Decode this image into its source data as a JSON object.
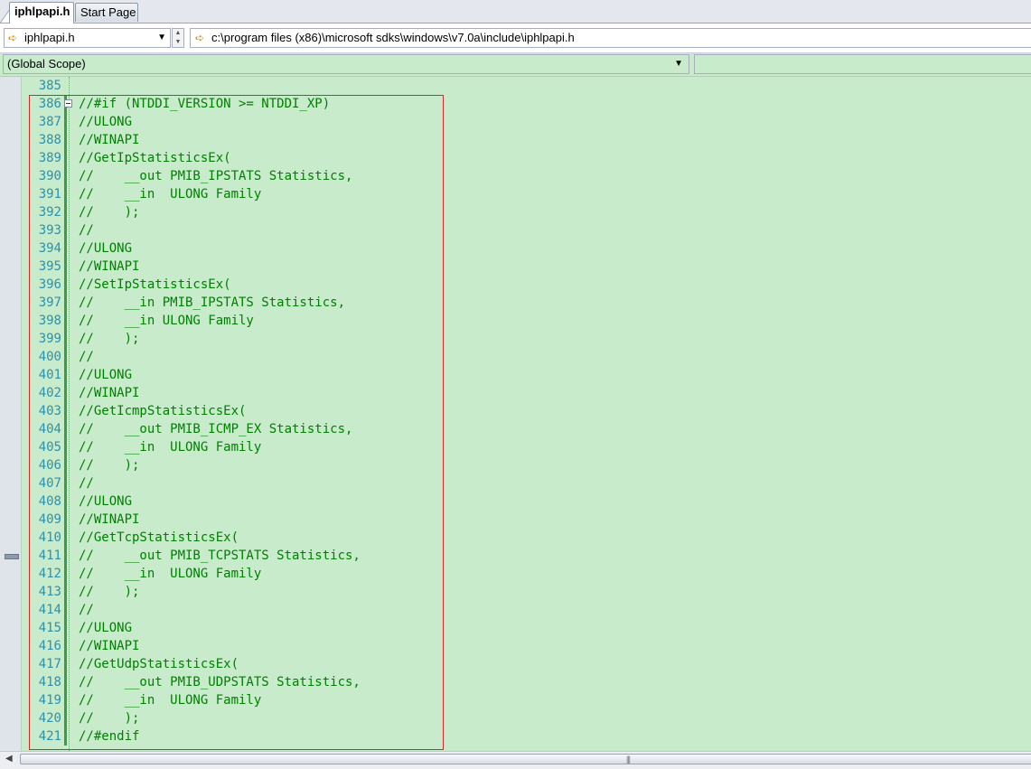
{
  "tabs": [
    {
      "label": "iphlpapi.h",
      "active": true
    },
    {
      "label": "Start Page",
      "active": false
    }
  ],
  "navbar": {
    "file": "iphlpapi.h",
    "path": "c:\\program files (x86)\\microsoft sdks\\windows\\v7.0a\\include\\iphlpapi.h",
    "file_icon": "arrow-right-icon"
  },
  "scope": {
    "label": "(Global Scope)",
    "member": ""
  },
  "colors": {
    "editor_bg": "#c7ebcb",
    "comment": "#008000",
    "line_number": "#2b91af",
    "highlight_box": "#e02424"
  },
  "code": {
    "lines": [
      {
        "n": "385",
        "t": ""
      },
      {
        "n": "386",
        "t": "//#if (NTDDI_VERSION >= NTDDI_XP)",
        "fold": true
      },
      {
        "n": "387",
        "t": "//ULONG"
      },
      {
        "n": "388",
        "t": "//WINAPI"
      },
      {
        "n": "389",
        "t": "//GetIpStatisticsEx("
      },
      {
        "n": "390",
        "t": "//    __out PMIB_IPSTATS Statistics,"
      },
      {
        "n": "391",
        "t": "//    __in  ULONG Family"
      },
      {
        "n": "392",
        "t": "//    );"
      },
      {
        "n": "393",
        "t": "//"
      },
      {
        "n": "394",
        "t": "//ULONG"
      },
      {
        "n": "395",
        "t": "//WINAPI"
      },
      {
        "n": "396",
        "t": "//SetIpStatisticsEx("
      },
      {
        "n": "397",
        "t": "//    __in PMIB_IPSTATS Statistics,"
      },
      {
        "n": "398",
        "t": "//    __in ULONG Family"
      },
      {
        "n": "399",
        "t": "//    );"
      },
      {
        "n": "400",
        "t": "//"
      },
      {
        "n": "401",
        "t": "//ULONG"
      },
      {
        "n": "402",
        "t": "//WINAPI"
      },
      {
        "n": "403",
        "t": "//GetIcmpStatisticsEx("
      },
      {
        "n": "404",
        "t": "//    __out PMIB_ICMP_EX Statistics,"
      },
      {
        "n": "405",
        "t": "//    __in  ULONG Family"
      },
      {
        "n": "406",
        "t": "//    );"
      },
      {
        "n": "407",
        "t": "//"
      },
      {
        "n": "408",
        "t": "//ULONG"
      },
      {
        "n": "409",
        "t": "//WINAPI"
      },
      {
        "n": "410",
        "t": "//GetTcpStatisticsEx("
      },
      {
        "n": "411",
        "t": "//    __out PMIB_TCPSTATS Statistics,"
      },
      {
        "n": "412",
        "t": "//    __in  ULONG Family"
      },
      {
        "n": "413",
        "t": "//    );"
      },
      {
        "n": "414",
        "t": "//"
      },
      {
        "n": "415",
        "t": "//ULONG"
      },
      {
        "n": "416",
        "t": "//WINAPI"
      },
      {
        "n": "417",
        "t": "//GetUdpStatisticsEx("
      },
      {
        "n": "418",
        "t": "//    __out PMIB_UDPSTATS Statistics,"
      },
      {
        "n": "419",
        "t": "//    __in  ULONG Family"
      },
      {
        "n": "420",
        "t": "//    );"
      },
      {
        "n": "421",
        "t": "//#endif"
      }
    ]
  }
}
